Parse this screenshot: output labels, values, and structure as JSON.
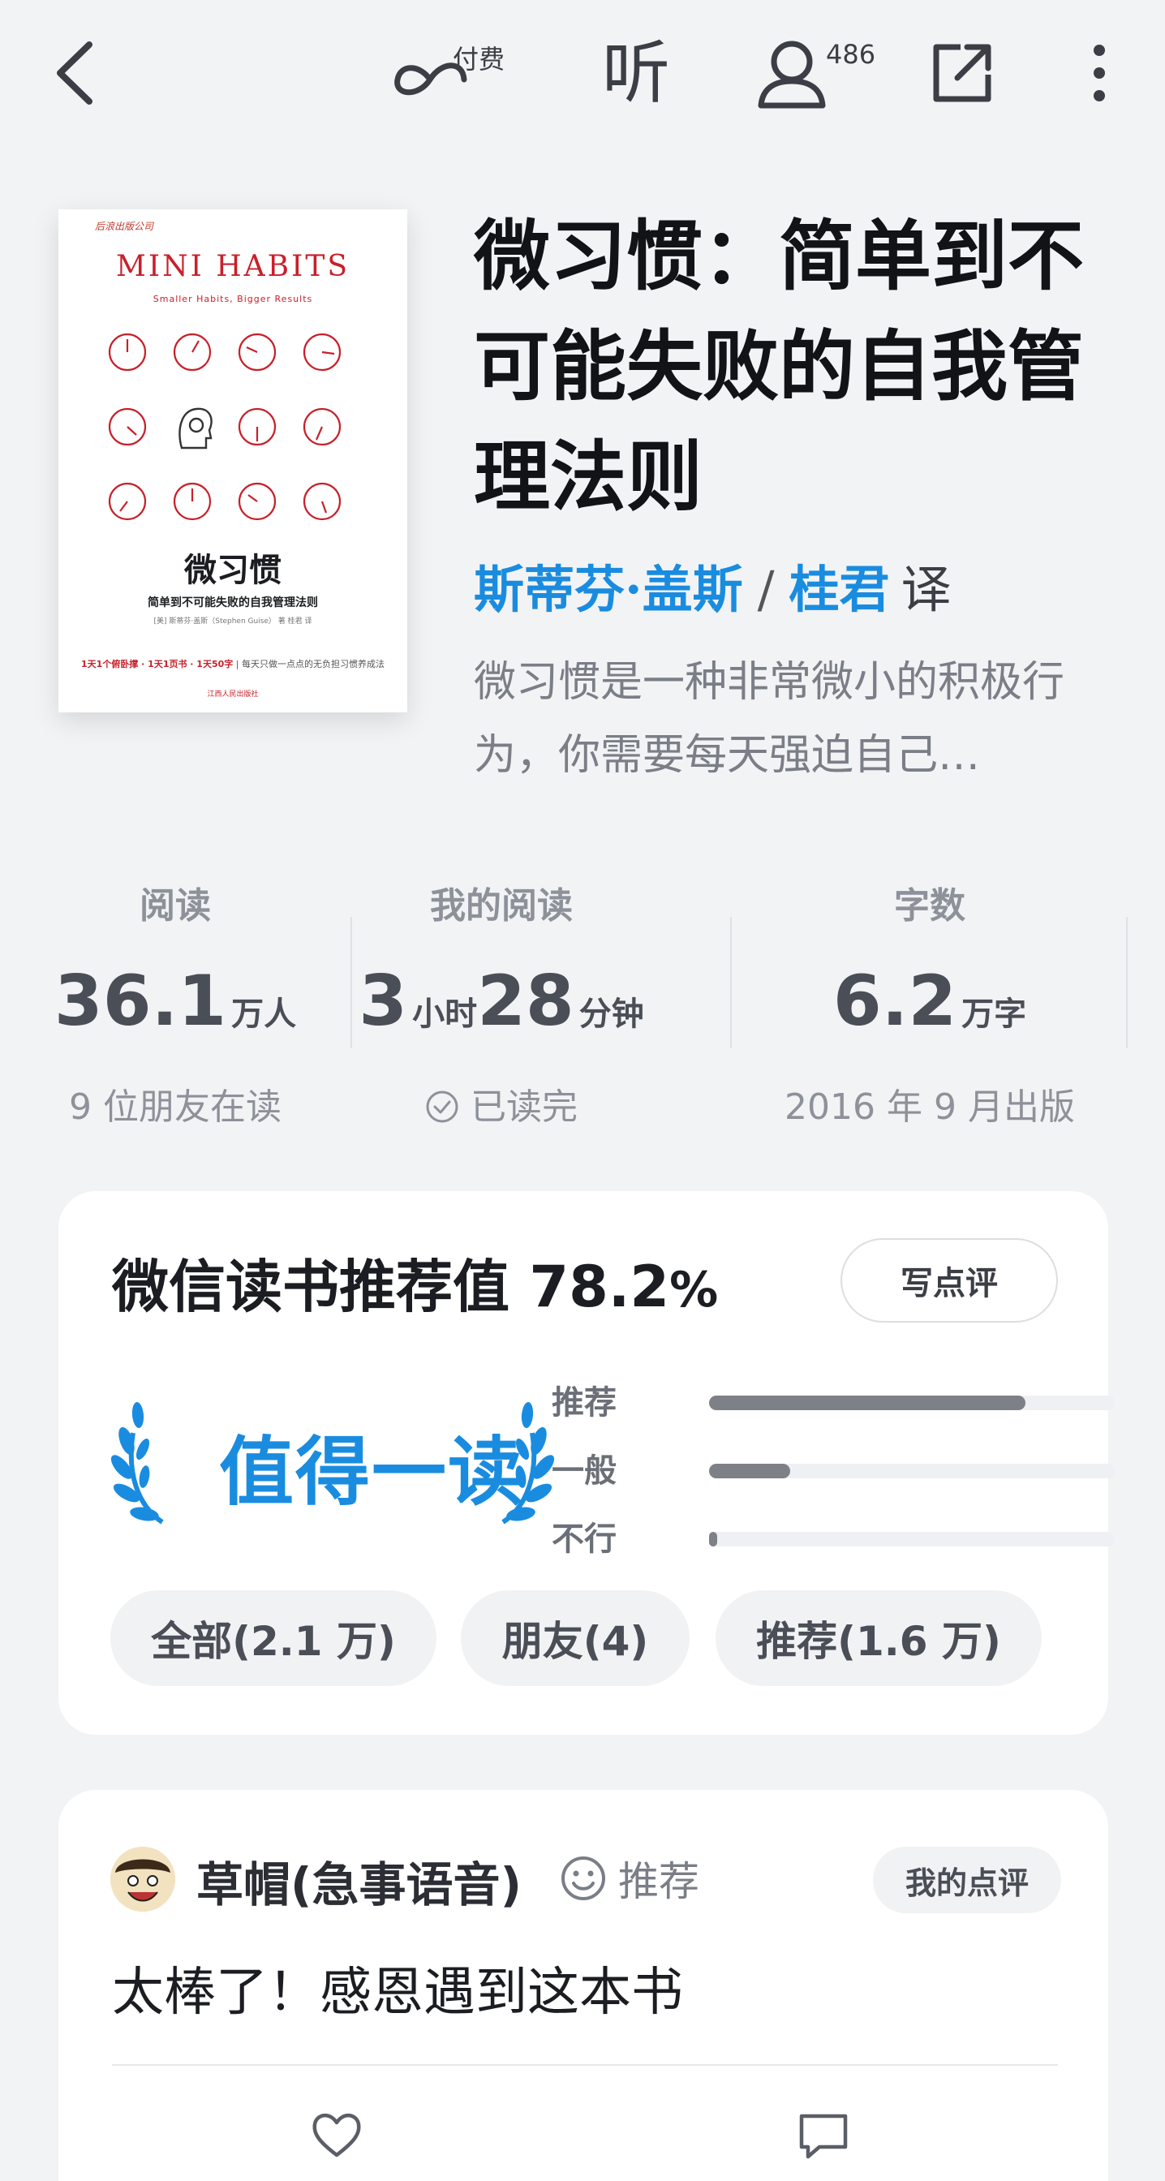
{
  "topbar": {
    "back_icon": "chevron-left-icon",
    "paid_label": "付费",
    "listen_label": "听",
    "readers_count": "486",
    "share_icon": "share-external-icon",
    "more_icon": "more-vertical-icon"
  },
  "book": {
    "cover": {
      "publisher": "后浪出版公司",
      "title_en": "MINI HABITS",
      "subtitle_en": "Smaller Habits, Bigger Results",
      "title_cn": "微习惯",
      "subtitle_cn": "简单到不可能失败的自我管理法则",
      "author_line": "[美] 斯蒂芬·盖斯（Stephen Guise） 著    桂君 译",
      "tagline_red": "1天1个俯卧撑 · 1天1页书 · 1天50字",
      "tagline_rest": "每天只做一点点的无负担习惯养成法",
      "press": "江西人民出版社"
    },
    "title": "微习惯：简单到不可能失败的自我管理法则",
    "author": "斯蒂芬·盖斯",
    "separator": "/",
    "translator": "桂君",
    "translator_role": "译",
    "intro": "微习惯是一种非常微小的积极行为，你需要每天强迫自己…"
  },
  "stats": [
    {
      "label": "阅读",
      "value": "36.1",
      "unit": "万人",
      "footer": "9 位朋友在读"
    },
    {
      "label": "我的阅读",
      "value_a": "3",
      "unit_a": "小时",
      "value_b": "28",
      "unit_b": "分钟",
      "footer": "已读完"
    },
    {
      "label": "字数",
      "value": "6.2",
      "unit": "万字",
      "footer": "2016 年 9 月出版"
    }
  ],
  "rating": {
    "title": "微信读书推荐值 78.2",
    "percent_sign": "%",
    "write_review": "写点评",
    "badge": "值得一读",
    "bars": [
      {
        "label": "推荐",
        "fraction": 0.78
      },
      {
        "label": "一般",
        "fraction": 0.2
      },
      {
        "label": "不行",
        "fraction": 0.02
      }
    ],
    "filters": [
      "全部(2.1 万)",
      "朋友(4)",
      "推荐(1.6 万)"
    ],
    "colors": {
      "accent": "#1a8ce0",
      "bar_fill": "#7d8087"
    }
  },
  "comment": {
    "user": "草帽(急事语音)",
    "verdict": "推荐",
    "mine_label": "我的点评",
    "text": "太棒了！感恩遇到这本书",
    "like_icon": "heart-icon",
    "reply_icon": "comment-icon"
  }
}
